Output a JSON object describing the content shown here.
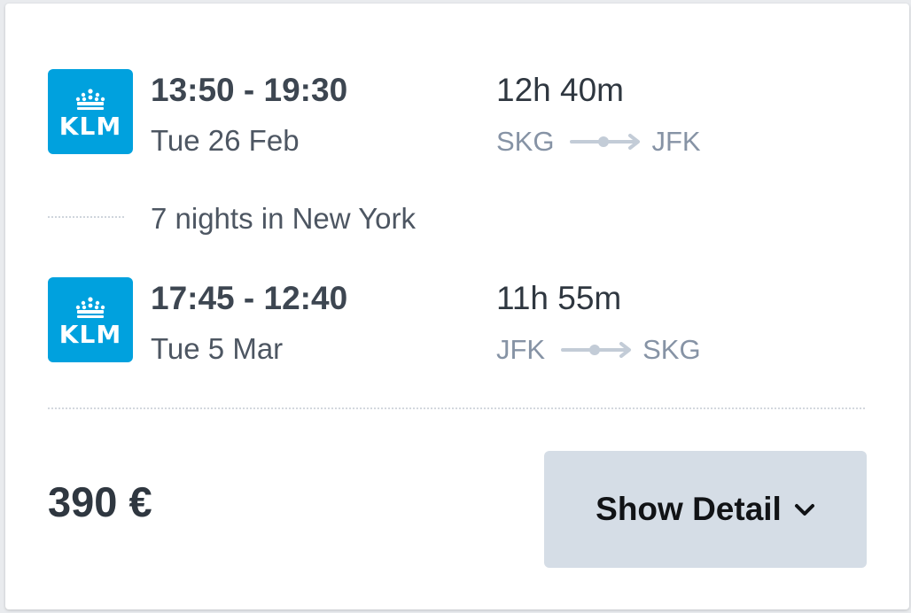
{
  "outbound": {
    "airline_logo_text": "KLM",
    "times": "13:50 - 19:30",
    "date": "Tue 26 Feb",
    "duration": "12h 40m",
    "from": "SKG",
    "to": "JFK"
  },
  "stay": {
    "text": "7 nights in New York"
  },
  "return": {
    "airline_logo_text": "KLM",
    "times": "17:45 - 12:40",
    "date": "Tue 5 Mar",
    "duration": "11h 55m",
    "from": "JFK",
    "to": "SKG"
  },
  "footer": {
    "price": "390 €",
    "show_detail_label": "Show Detail",
    "show_detail_icon": "chevron-down-icon"
  },
  "colors": {
    "klm_blue": "#00a1de",
    "button_bg": "#d5dde6",
    "muted_route": "#8693a5"
  }
}
